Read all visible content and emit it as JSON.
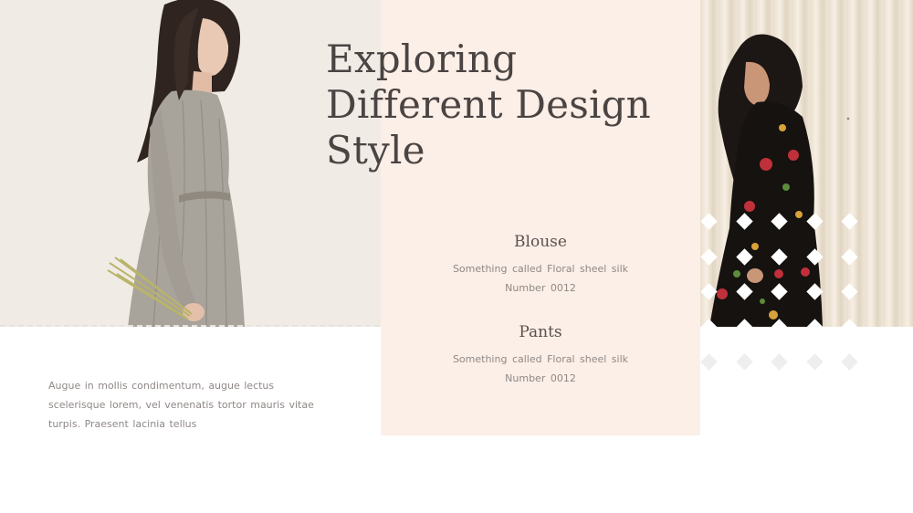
{
  "slide": {
    "title": "Exploring Different Design Style",
    "paragraph": "Augue in mollis condimentum, augue lectus scelerisque lorem, vel venenatis tortor mauris vitae turpis. Praesent lacinia tellus",
    "items": [
      {
        "title": "Blouse",
        "description": "Something called Floral sheel silk",
        "number": "Number 0012"
      },
      {
        "title": "Pants",
        "description": "Something called Floral sheel silk",
        "number": "Number 0012"
      }
    ]
  },
  "colors": {
    "peach_panel": "#fcefe7",
    "left_photo_bg": "#f0ebe5",
    "title": "#4a4443",
    "body_text": "#8f8886",
    "diamond_on_photo": "#ffffff",
    "diamond_on_white": "#eeeeee"
  },
  "images": {
    "left": "woman-in-gray-linen-dress-photo",
    "right": "woman-in-black-floral-dress-photo"
  }
}
